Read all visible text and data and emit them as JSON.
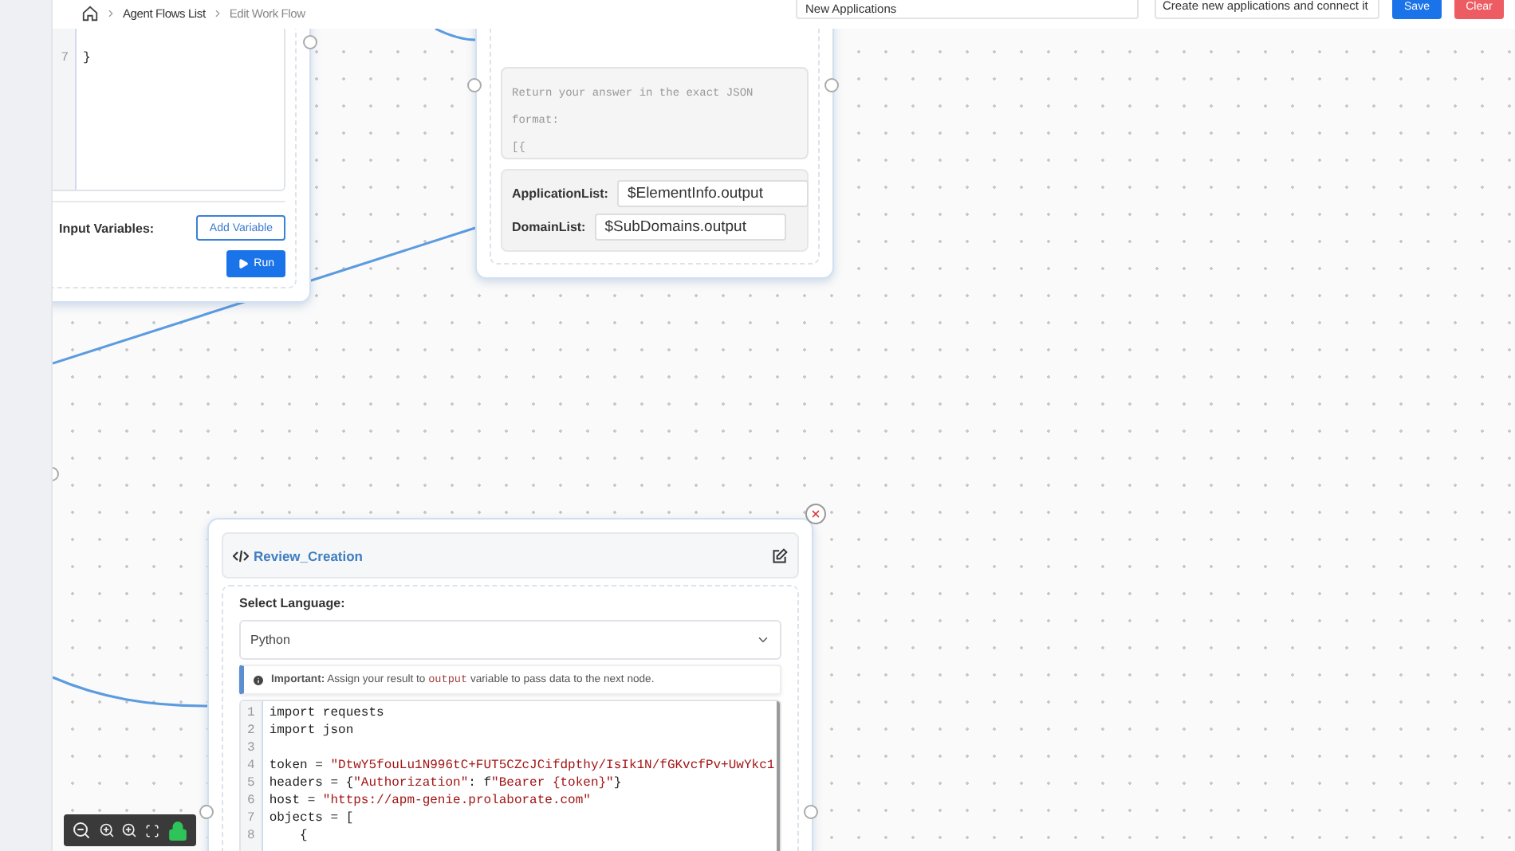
{
  "header": {
    "breadcrumb": [
      {
        "label": "Agent Flows List",
        "current": false
      },
      {
        "label": "Edit Work Flow",
        "current": true
      }
    ],
    "flow_name": {
      "value": "New Applications"
    },
    "flow_description": {
      "value": "Create new applications and connect it"
    },
    "buttons": [
      {
        "label": "Save",
        "kind": "primary"
      },
      {
        "label": "Clear",
        "kind": "danger"
      }
    ]
  },
  "code_node": {
    "line_numbers": [
      "7"
    ],
    "code_lines": [
      "}"
    ],
    "input_variables_label": "Input Variables:",
    "add_variable_button": "Add Variable",
    "run_button": "Run"
  },
  "prompt_node": {
    "prompt_lines": [
      "Return your answer in the exact JSON",
      "format:",
      "[{"
    ],
    "variables": [
      {
        "label": "ApplicationList:",
        "value": "$ElementInfo.output"
      },
      {
        "label": "DomainList:",
        "value": "$SubDomains.output"
      }
    ]
  },
  "review_node": {
    "title": "Review_Creation",
    "select_language_label": "Select Language:",
    "language": "Python",
    "notice": {
      "label": "Important:",
      "before": "Assign your result to",
      "code": "output",
      "after": "variable to pass data to the next node."
    },
    "code": [
      {
        "number": "1",
        "parts": [
          {
            "kind": "plain",
            "text": "import requests"
          }
        ]
      },
      {
        "number": "2",
        "parts": [
          {
            "kind": "plain",
            "text": "import json"
          }
        ]
      },
      {
        "number": "3"
      },
      {
        "number": "4",
        "parts": [
          {
            "kind": "plain",
            "text": "token = "
          },
          {
            "kind": "string",
            "text": "\"DtwY5fouLu1N996tC+FUT5CZcJCifdpthy/IsIk1N/fGKvcfPv+UwYkc1"
          }
        ]
      },
      {
        "number": "5",
        "parts": [
          {
            "kind": "plain",
            "text": "headers = {"
          },
          {
            "kind": "string",
            "text": "\"Authorization\""
          },
          {
            "kind": "plain",
            "text": ": f"
          },
          {
            "kind": "string",
            "text": "\"Bearer {token}\""
          },
          {
            "kind": "plain",
            "text": "}"
          }
        ]
      },
      {
        "number": "6",
        "parts": [
          {
            "kind": "plain",
            "text": "host = "
          },
          {
            "kind": "string",
            "text": "\"https://apm-genie.prolaborate.com\""
          }
        ]
      },
      {
        "number": "7",
        "parts": [
          {
            "kind": "plain",
            "text": "objects = ["
          }
        ]
      },
      {
        "number": "8",
        "parts": [
          {
            "kind": "plain",
            "text": "    {"
          }
        ]
      }
    ]
  }
}
